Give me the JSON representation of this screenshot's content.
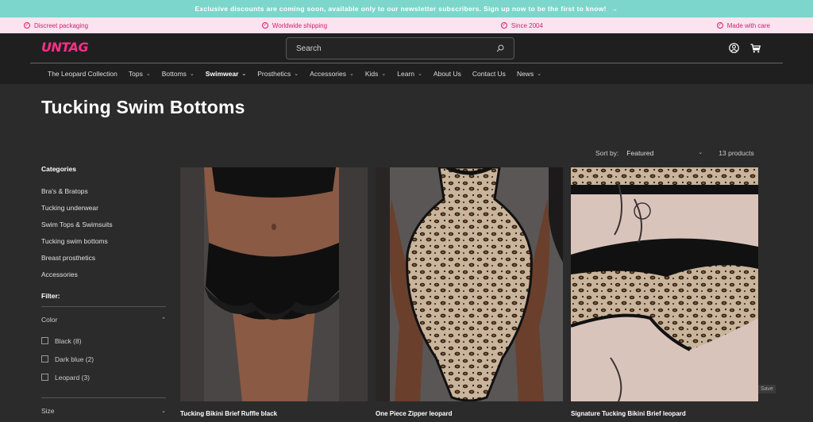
{
  "announcement": {
    "text": "Exclusive discounts are coming soon, available only to our newsletter subscribers. Sign up now to be the first to know!",
    "arrow": "→"
  },
  "usps": [
    "Discreet packaging",
    "Worldwide shipping",
    "Since 2004",
    "Made with care"
  ],
  "header": {
    "logo": "UNTAG",
    "search_placeholder": "Search"
  },
  "nav": [
    {
      "label": "The Leopard Collection",
      "chevron": false
    },
    {
      "label": "Tops",
      "chevron": true
    },
    {
      "label": "Bottoms",
      "chevron": true
    },
    {
      "label": "Swimwear",
      "chevron": true,
      "active": true
    },
    {
      "label": "Prosthetics",
      "chevron": true
    },
    {
      "label": "Accessories",
      "chevron": true
    },
    {
      "label": "Kids",
      "chevron": true
    },
    {
      "label": "Learn",
      "chevron": true
    },
    {
      "label": "About Us",
      "chevron": false
    },
    {
      "label": "Contact Us",
      "chevron": false
    },
    {
      "label": "News",
      "chevron": true
    }
  ],
  "page": {
    "title": "Tucking Swim Bottoms"
  },
  "sort": {
    "label": "Sort by:",
    "value": "Featured",
    "count": "13 products"
  },
  "sidebar": {
    "categories_title": "Categories",
    "categories": [
      "Bra's & Bratops",
      "Tucking underwear",
      "Swim Tops & Swimsuits",
      "Tucking swim bottoms",
      "Breast prosthetics",
      "Accessories"
    ],
    "filter_title": "Filter:",
    "color_title": "Color",
    "color_options": [
      "Black (8)",
      "Dark blue (2)",
      "Leopard (3)"
    ],
    "size_title": "Size"
  },
  "products": [
    {
      "title": "Tucking Bikini Brief Ruffle black"
    },
    {
      "title": "One Piece Zipper leopard"
    },
    {
      "title": "Signature Tucking Bikini Brief leopard"
    }
  ],
  "save_badge": "Save",
  "colors": {
    "accent": "#ff2f87",
    "announce_bg": "#7dd6cb",
    "usp_bg": "#fbe3ef",
    "usp_text": "#d0246b"
  }
}
